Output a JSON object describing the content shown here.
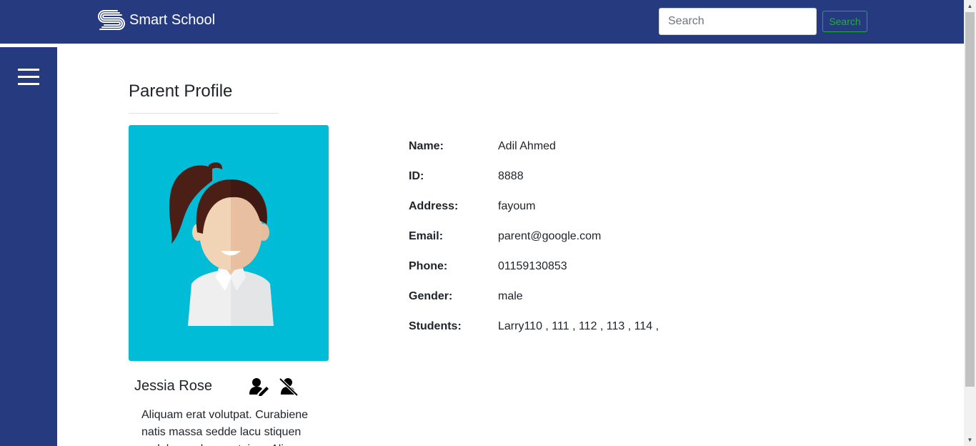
{
  "navbar": {
    "brand": "Smart School",
    "search_placeholder": "Search",
    "search_button": "Search"
  },
  "page": {
    "title": "Parent Profile"
  },
  "profile": {
    "name": "Jessia Rose",
    "bio": "Aliquam erat volutpat. Curabiene natis massa sedde lacu stiquen sodale word moun taiery. Aliquam erat"
  },
  "details": [
    {
      "label": "Name:",
      "value": "Adil Ahmed"
    },
    {
      "label": "ID:",
      "value": "8888"
    },
    {
      "label": "Address:",
      "value": "fayoum"
    },
    {
      "label": "Email:",
      "value": "parent@google.com"
    },
    {
      "label": "Phone:",
      "value": "01159130853"
    },
    {
      "label": "Gender:",
      "value": "male"
    },
    {
      "label": "Students:",
      "value": "Larry110 , 111 , 112 , 113 , 114 ,"
    }
  ],
  "icons": {
    "brand": "stacked-s-logo-icon",
    "menu": "hamburger-menu-icon",
    "edit": "user-edit-icon",
    "delete": "user-slash-icon"
  },
  "colors": {
    "primary": "#263a80",
    "avatar_bg": "#00bcd6",
    "search_button": "#28a745"
  }
}
